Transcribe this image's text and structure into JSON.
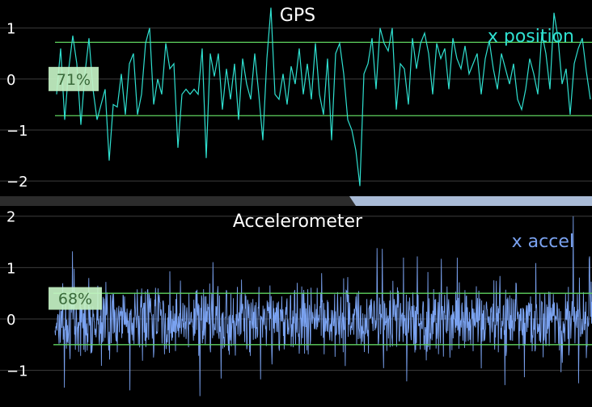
{
  "colors": {
    "background": "#000000",
    "panel_edge": "#2a2a2a",
    "separator": "#8fa4c4",
    "gridline": "#3c3c3c",
    "threshold": "#5fd35f",
    "badge": "#c4f2c4",
    "badge_text": "#3a6a3a",
    "axis_text": "#ffffff"
  },
  "chart_data": [
    {
      "type": "line",
      "title": "GPS",
      "xlabel": "",
      "ylabel": "",
      "ylim": [
        -2.3,
        1.55
      ],
      "yticks": [
        1,
        0,
        -1,
        -2
      ],
      "ytick_labels": [
        "1",
        "0",
        "−1",
        "−2"
      ],
      "grid": true,
      "legend_position": "top-right",
      "thresholds": [
        0.72,
        -0.72
      ],
      "badge": {
        "label": "71%",
        "y": 0
      },
      "series": [
        {
          "name": "x position",
          "color": "#2fe0d0",
          "x": [
            70,
            75,
            80,
            85,
            90,
            95,
            100,
            105,
            110,
            115,
            120,
            125,
            130,
            135,
            140,
            145,
            150,
            155,
            160,
            165,
            170,
            175,
            180,
            185,
            190,
            195,
            200,
            205,
            210,
            215,
            220,
            225,
            230,
            235,
            240,
            245,
            250,
            255,
            260,
            265,
            270,
            275,
            280,
            285,
            290,
            295,
            300,
            305,
            310,
            315,
            320,
            325,
            330,
            335,
            340,
            345,
            350,
            355,
            360,
            365,
            370,
            375,
            380,
            385,
            390,
            395,
            400,
            405,
            410,
            415,
            420,
            425,
            430,
            435,
            440,
            445,
            450,
            455,
            460,
            465,
            470,
            475,
            480,
            485,
            490,
            495,
            500,
            505,
            510,
            515,
            520,
            525,
            530,
            535,
            540,
            545,
            550,
            555,
            560,
            565,
            570,
            575,
            580,
            585,
            590,
            595,
            600,
            605,
            610,
            615,
            620,
            625,
            630,
            635,
            640,
            645,
            650,
            655,
            660,
            665,
            670,
            675,
            680,
            685,
            690,
            695,
            700,
            705,
            710,
            715,
            720,
            725,
            730
          ],
          "y": [
            -0.3,
            0.6,
            -0.8,
            0.2,
            0.85,
            0.3,
            -0.9,
            0.1,
            0.8,
            -0.2,
            -0.8,
            -0.5,
            -0.2,
            -1.6,
            -0.5,
            -0.55,
            0.1,
            -0.7,
            0.3,
            0.5,
            -0.7,
            -0.3,
            0.7,
            1.0,
            -0.5,
            0.0,
            -0.3,
            0.7,
            0.2,
            0.3,
            -1.35,
            -0.3,
            -0.2,
            -0.3,
            -0.2,
            -0.3,
            0.6,
            -1.55,
            0.5,
            0.05,
            0.5,
            -0.6,
            0.2,
            -0.4,
            0.3,
            -0.8,
            0.4,
            -0.1,
            -0.4,
            0.5,
            -0.3,
            -1.2,
            0.4,
            1.4,
            -0.3,
            -0.4,
            0.1,
            -0.5,
            0.25,
            -0.1,
            0.6,
            -0.3,
            0.3,
            -0.4,
            0.7,
            -0.3,
            -0.7,
            0.4,
            -1.2,
            0.5,
            0.7,
            0.1,
            -0.8,
            -1.0,
            -1.4,
            -2.1,
            0.1,
            0.3,
            0.8,
            -0.2,
            1.0,
            0.7,
            0.55,
            1.0,
            -0.6,
            0.3,
            0.2,
            -0.5,
            0.8,
            0.2,
            0.7,
            0.9,
            0.5,
            -0.3,
            0.7,
            0.4,
            0.6,
            -0.2,
            0.8,
            0.4,
            0.2,
            0.65,
            0.1,
            0.3,
            0.5,
            -0.3,
            0.4,
            0.75,
            0.2,
            -0.2,
            0.5,
            0.2,
            -0.1,
            0.3,
            -0.4,
            -0.6,
            -0.2,
            0.4,
            0.1,
            -0.3,
            0.9,
            0.5,
            -0.2,
            1.3,
            0.8,
            -0.1,
            0.2,
            -0.7,
            0.3,
            0.6,
            0.8,
            0.15,
            -0.4
          ]
        }
      ]
    },
    {
      "type": "line",
      "title": "Accelerometer",
      "xlabel": "",
      "ylabel": "",
      "ylim": [
        -1.65,
        2.2
      ],
      "yticks": [
        2,
        1,
        0,
        -1
      ],
      "ytick_labels": [
        "2",
        "1",
        "0",
        "−1"
      ],
      "grid": true,
      "legend_position": "top-right",
      "thresholds": [
        0.5,
        -0.5
      ],
      "badge": {
        "label": "68%",
        "y": 0.4
      },
      "series": [
        {
          "name": "x accel",
          "color": "#7aa2f0",
          "points": 1320,
          "x_range": [
            68,
            732
          ],
          "amplitude": 0.42,
          "extremes_min": -1.5,
          "extremes_max": 2.0
        }
      ]
    }
  ]
}
